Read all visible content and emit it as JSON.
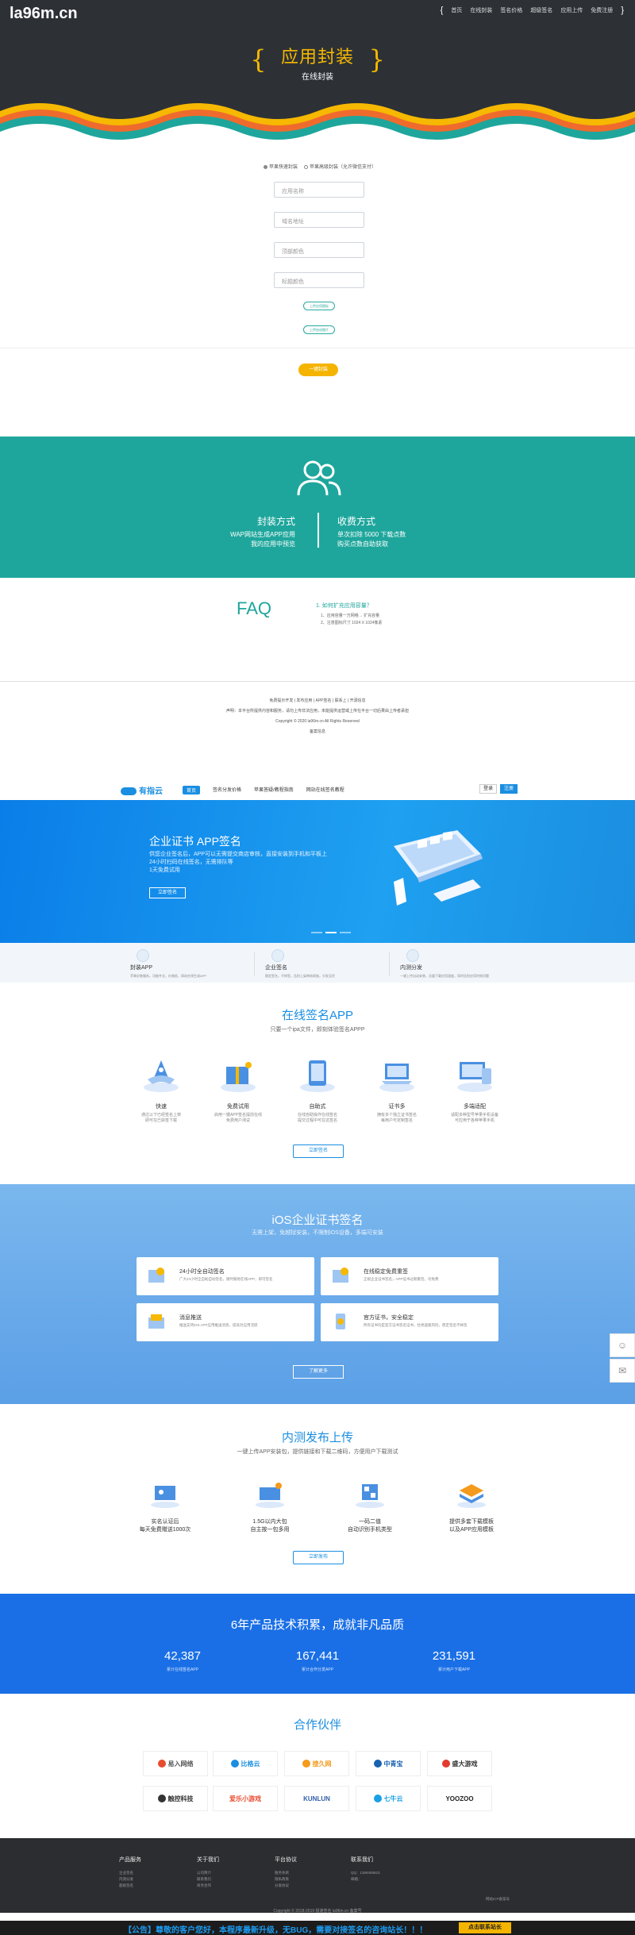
{
  "header": {
    "logo": "la96m.cn",
    "nav": [
      "首页",
      "在线封装",
      "签名价格",
      "超级签名",
      "应用上传",
      "免费注册"
    ],
    "hero_title": "应用封装",
    "hero_sub": "在线封装",
    "brace_left": "{",
    "brace_right": "}"
  },
  "form": {
    "radio1": "苹果快速封装",
    "radio2": "苹果高级封装（允许微信支付）",
    "app_name_ph": "应用名称",
    "url_ph": "域名地址",
    "top_color_ph": "顶部颜色",
    "title_color_ph": "标题颜色",
    "upload_icon": "上传应用图标",
    "upload_splash": "上传启动图片",
    "submit": "一键封装"
  },
  "teal": {
    "left_title": "封装方式",
    "left_text1": "WAP网站生成APP应用",
    "left_text2": "我的应用中预览",
    "right_title": "收费方式",
    "right_text1": "单次扣除 5000 下载点数",
    "right_text2": "购买点数自助获取"
  },
  "faq": {
    "title": "FAQ",
    "q": "1. 如何扩充应用容量？",
    "a1": "1、应用容量一万网络→ 扩充容量",
    "a2": "2、注意图标尺寸 1024 X 1024像素"
  },
  "footer1": {
    "links": "免费提示开发 | 发布应用 | APP签名 | 联系上 | 开源信息",
    "notice": "声明：本平台所提供内容和服务，请勿上传非法应用，未能提供运营或上传在平台一切后果由上传者承担",
    "copyright": "Copyright © 2020 la96m.cn All Rights Reserved",
    "icp": "备案信息"
  },
  "nav2": {
    "logo": "有指云",
    "logo_sub": "SIGN HUB",
    "items": [
      "首页",
      "签名分发价格",
      "苹果答疑/教程指南",
      "网站在线签名教程"
    ],
    "login": "登录",
    "register": "注册"
  },
  "banner": {
    "title": "企业证书 APP签名",
    "desc1": "供您企业签名后，APP可以无需提交商店审核，直接安装到手机和平板上",
    "desc2": "24小时扫码在线签名，无需排队等",
    "desc3": "1天免费试用",
    "button": "立即签名"
  },
  "features3": [
    {
      "title": "封装APP",
      "desc": "苹果封装服务，功能齐全，价格低，网站在线生成APP"
    },
    {
      "title": "企业签名",
      "desc": "稳定签名，不掉签，告别上架审核烦恼，分发无忧"
    },
    {
      "title": "内测分发",
      "desc": "一键上传自动安装，总量下载应用速度，同时告别应用时效问题"
    }
  ],
  "online": {
    "title": "在线签名APP",
    "subtitle": "只要一个ipa文件，即刻体验签名APPP",
    "items": [
      {
        "name": "快速",
        "desc1": "通过以下已经签名上架",
        "desc2": "即可在已获签下载"
      },
      {
        "name": "免费试用",
        "desc1": "启用一键APP签名提前在线",
        "desc2": "免费用户测试"
      },
      {
        "name": "自助式",
        "desc1": "在线自助操作在线签名",
        "desc2": "提交过程中可在这签名"
      },
      {
        "name": "证书多",
        "desc1": "拥有多个独立证书签名",
        "desc2": "每用户可定制签名"
      },
      {
        "name": "多端适配",
        "desc1": "适配多种型号苹果手机设备",
        "desc2": "可应用于各种苹果手机"
      }
    ],
    "button": "立即签名"
  },
  "ios": {
    "title": "iOS企业证书签名",
    "subtitle": "无需上架，免越狱安装，不限制iOS设备，多端可安装",
    "cards": [
      {
        "title": "24小时全自动签名",
        "desc": "广大24小时全自助自动签名，随时随地在线APP，即可签名"
      },
      {
        "title": "在线稳定免费重签",
        "desc": "正规企业证书签名，APP证书过期重签，均免费"
      },
      {
        "title": "消息推送",
        "desc": "推送支持iOS APP应用推送消息，提高对应用活跃"
      },
      {
        "title": "官方证书，安全稳定",
        "desc": "所有证书均是官方证书签名证书，杜绝盗版风险，稳定签名不掉签"
      }
    ],
    "button": "了解更多"
  },
  "beta": {
    "title": "内测发布上传",
    "subtitle": "一键上传APP安装包，提供链接和下载二维码，方便用户下载测试",
    "items": [
      {
        "l1": "实名认证后",
        "l2": "每天免费赠送1000次"
      },
      {
        "l1": "1.5G以内大包",
        "l2": "自主按一包多用"
      },
      {
        "l1": "一码二值",
        "l2": "自动识别手机类型"
      },
      {
        "l1": "提供多套下载模板",
        "l2": "以及APP应用模板"
      }
    ],
    "button": "立即发布"
  },
  "stats": {
    "title": "6年产品技术积累，成就非凡品质",
    "items": [
      {
        "num": "42,387",
        "label": "累计在线签名APP"
      },
      {
        "num": "167,441",
        "label": "累计合作分发APP"
      },
      {
        "num": "231,591",
        "label": "累计用户下载APP"
      }
    ]
  },
  "partners": {
    "title": "合作伙伴",
    "logos": [
      "易入网络",
      "比格云",
      "搜久网",
      "中青宝",
      "盛大游戏",
      "触控科技",
      "爱乐小游戏",
      "KUNLUN",
      "七牛云",
      "YOOZOO"
    ],
    "colors": [
      "#e94b2f",
      "#1b8ee1",
      "#f49a1c",
      "#1962b0",
      "#e23b2e",
      "#333333",
      "#f49a1c",
      "#2f5ea8",
      "#1aa0e4",
      "#222222"
    ]
  },
  "footer2": {
    "cols": [
      {
        "h": "产品服务",
        "items": [
          "企业签名",
          "内测分发",
          "超级签名"
        ]
      },
      {
        "h": "关于我们",
        "items": [
          "公司简介",
          "联系我们",
          "商务合作"
        ]
      },
      {
        "h": "平台协议",
        "items": [
          "服务条款",
          "隐私政策",
          "分发协议"
        ]
      },
      {
        "h": "联系我们",
        "items": [
          "QQ：1369459823",
          "邮箱："
        ]
      }
    ],
    "icp": "网站ICP备案号",
    "copyright": "Copyright © 2018-2019 极速签名 la96m.cn 备案号"
  },
  "notice": {
    "text": "【公告】尊敬的客户您好，本程序最新升级，无BUG，需要对接签名的咨询站长！！！",
    "button": "点击联系站长"
  }
}
